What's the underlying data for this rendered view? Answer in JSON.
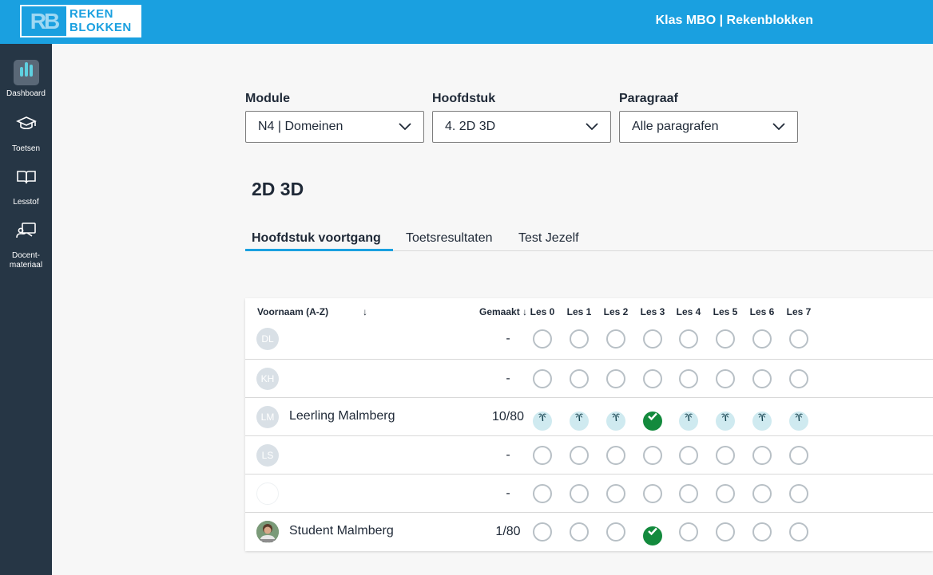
{
  "header": {
    "logo_mark": "RB",
    "logo_line1": "REKEN",
    "logo_line2": "BLOKKEN",
    "app_title": "Klas MBO | Rekenblokken",
    "brand_color": "#1aa0e0"
  },
  "sidebar": {
    "items": [
      {
        "label": "Dashboard",
        "icon": "bar-chart-icon",
        "active": true
      },
      {
        "label": "Toetsen",
        "icon": "graduation-cap-icon"
      },
      {
        "label": "Lesstof",
        "icon": "book-icon"
      },
      {
        "label": "Docent-materiaal",
        "icon": "teacher-board-icon"
      }
    ]
  },
  "filters": {
    "module": {
      "label": "Module",
      "value": "N4 | Domeinen"
    },
    "hoofdstuk": {
      "label": "Hoofdstuk",
      "value": "4. 2D 3D"
    },
    "paragraaf": {
      "label": "Paragraaf",
      "value": "Alle paragrafen"
    }
  },
  "chapter_title": "2D 3D",
  "tabs": [
    {
      "label": "Hoofdstuk voortgang",
      "active": true
    },
    {
      "label": "Toetsresultaten"
    },
    {
      "label": "Test Jezelf"
    }
  ],
  "table": {
    "col_name": "Voornaam (A-Z)",
    "sort_arrow": "↓",
    "col_made": "Gemaakt ↓",
    "lessons": [
      "Les 0",
      "Les 1",
      "Les 2",
      "Les 3",
      "Les 4",
      "Les 5",
      "Les 6",
      "Les 7"
    ],
    "rows": [
      {
        "initials": "DL",
        "name": "",
        "made": "-",
        "status": [
          "empty",
          "empty",
          "empty",
          "empty",
          "empty",
          "empty",
          "empty",
          "empty"
        ]
      },
      {
        "initials": "KH",
        "name": "",
        "made": "-",
        "status": [
          "empty",
          "empty",
          "empty",
          "empty",
          "empty",
          "empty",
          "empty",
          "empty"
        ]
      },
      {
        "initials": "LM",
        "name": "Leerling Malmberg",
        "made": "10/80",
        "status": [
          "palm",
          "palm",
          "palm",
          "check",
          "palm",
          "palm",
          "palm",
          "palm"
        ]
      },
      {
        "initials": "LS",
        "name": "",
        "made": "-",
        "status": [
          "empty",
          "empty",
          "empty",
          "empty",
          "empty",
          "empty",
          "empty",
          "empty"
        ]
      },
      {
        "initials": "",
        "name": "",
        "made": "-",
        "status": [
          "empty",
          "empty",
          "empty",
          "empty",
          "empty",
          "empty",
          "empty",
          "empty"
        ]
      },
      {
        "initials": "",
        "name": "Student Malmberg",
        "made": "1/80",
        "photo": true,
        "status": [
          "empty",
          "empty",
          "empty",
          "check",
          "empty",
          "empty",
          "empty",
          "empty"
        ]
      }
    ]
  },
  "status_colors": {
    "check": "#138a3d",
    "palm": "#cfeaf0",
    "empty_border": "#b8c0c6"
  }
}
